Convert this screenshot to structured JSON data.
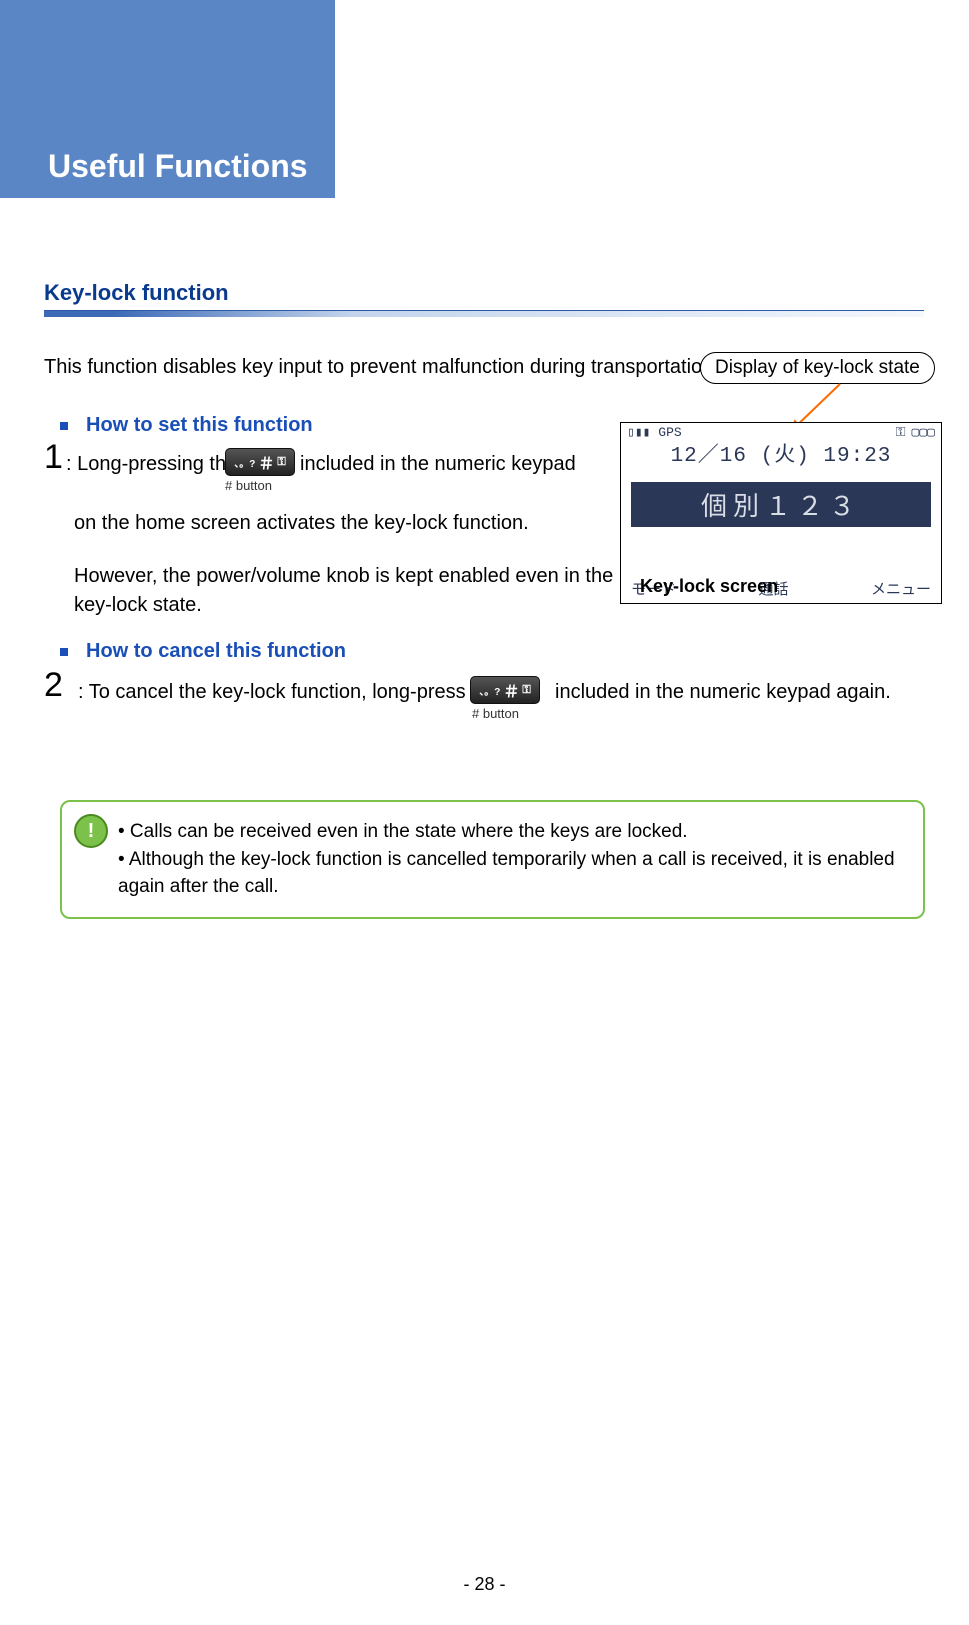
{
  "chapter_title": "Useful Functions",
  "section_heading": "Key-lock function",
  "intro": "This function disables key input to prevent malfunction during transportation.",
  "callout_display_label": "Display of key-lock state",
  "sub1": "How to set this function",
  "sub2": "How to cancel this function",
  "num1": "1",
  "num2": "2",
  "step1_pre": ": Long-pressing the",
  "step1_post": "included in the numeric keypad",
  "hash_label": "# button",
  "step1b": "on the home screen activates the key-lock function.",
  "step1c": "However, the power/volume knob is kept enabled even in the key-lock state.",
  "step2_pre": ": To cancel the key-lock function, long-press the",
  "step2_post": "included in the numeric keypad again.",
  "phone": {
    "status_left": "▯▮▮ GPS",
    "status_key_icon": "⚿",
    "status_batt": "▢▢▢",
    "datetime": "12／16 (火) 19:23",
    "band": "個別１２３",
    "soft_left": "モード",
    "soft_center": "通話",
    "soft_right": "メニュー",
    "overlay_label": "Key-lock screen"
  },
  "hash_button": {
    "sym_left": "、。?",
    "hash": "＃",
    "key_icon": "⚿"
  },
  "note": {
    "icon": "!",
    "line1": "• Calls can be received even in the state where the keys are locked.",
    "line2": "• Although the key-lock function is cancelled temporarily when a call is received, it is enabled again after the call."
  },
  "page_number": "- 28 -"
}
